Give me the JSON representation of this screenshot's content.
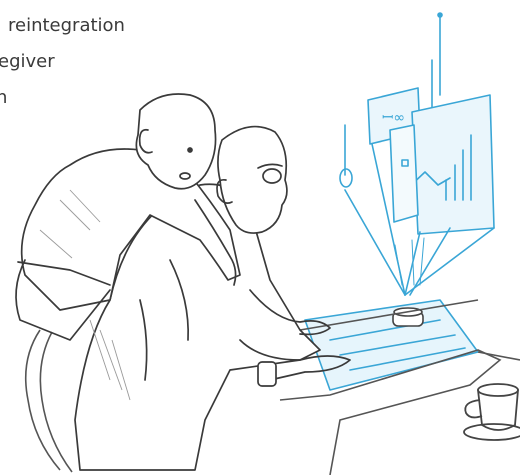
{
  "caption": {
    "line1": "reintegration",
    "line2": "egiver",
    "line3": "n"
  },
  "illustration": {
    "style": "pencil-sketch",
    "hologram_color": "#3aa6d6"
  }
}
